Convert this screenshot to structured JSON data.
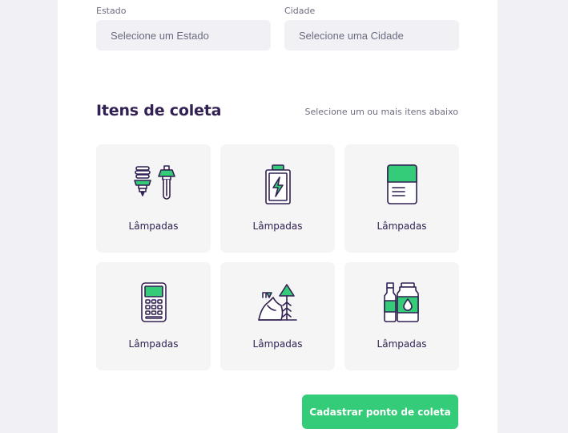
{
  "address": {
    "state_label": "Estado",
    "state_placeholder": "Selecione um Estado",
    "city_label": "Cidade",
    "city_placeholder": "Selecione uma Cidade"
  },
  "items_section": {
    "title": "Itens de coleta",
    "hint": "Selecione um ou mais itens abaixo",
    "items": [
      {
        "label": "Lâmpadas",
        "icon": "lamps-icon"
      },
      {
        "label": "Lâmpadas",
        "icon": "battery-icon"
      },
      {
        "label": "Lâmpadas",
        "icon": "paper-icon"
      },
      {
        "label": "Lâmpadas",
        "icon": "electronics-icon"
      },
      {
        "label": "Lâmpadas",
        "icon": "organic-icon"
      },
      {
        "label": "Lâmpadas",
        "icon": "oil-icon"
      }
    ]
  },
  "submit": {
    "label": "Cadastrar ponto de coleta"
  },
  "colors": {
    "accent": "#34cb79",
    "title": "#322153",
    "text": "#6c6c80",
    "background": "#f0f0f5"
  }
}
